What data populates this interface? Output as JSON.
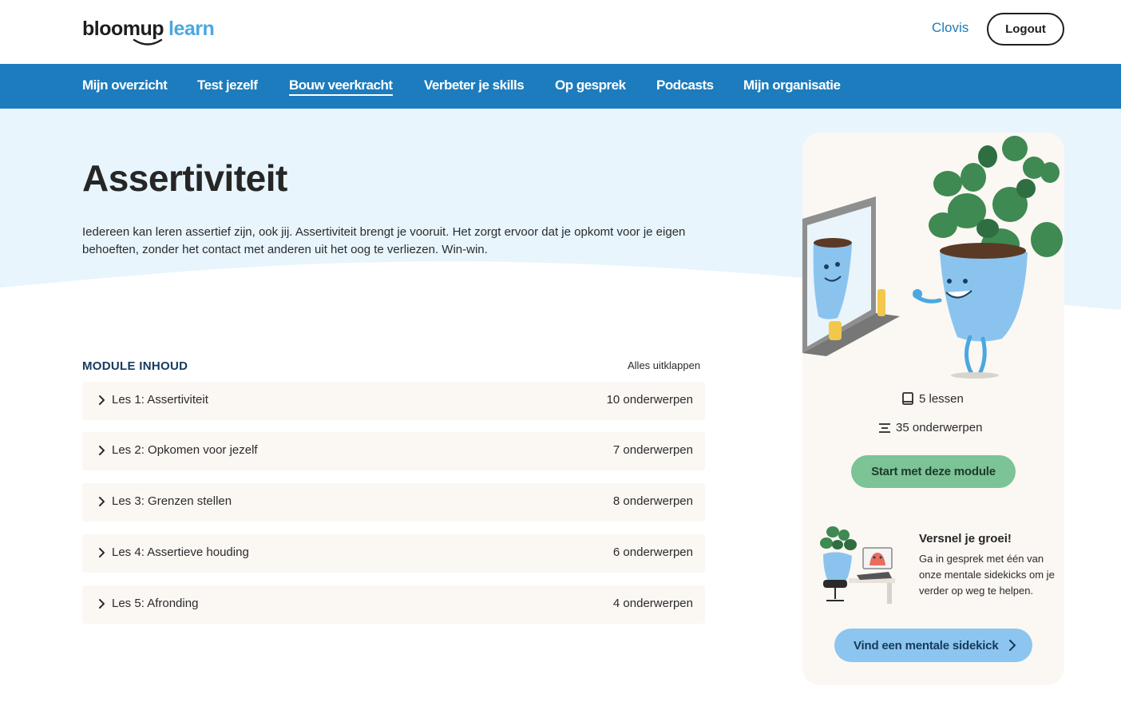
{
  "header": {
    "logo_part1": "bloomup",
    "logo_part2": "learn",
    "user_name": "Clovis",
    "logout_label": "Logout"
  },
  "nav": {
    "items": [
      {
        "label": "Mijn overzicht"
      },
      {
        "label": "Test jezelf"
      },
      {
        "label": "Bouw veerkracht"
      },
      {
        "label": "Verbeter je skills"
      },
      {
        "label": "Op gesprek"
      },
      {
        "label": "Podcasts"
      },
      {
        "label": "Mijn organisatie"
      }
    ],
    "active": "Bouw veerkracht"
  },
  "hero": {
    "title": "Assertiviteit",
    "description": "Iedereen kan leren assertief zijn, ook jij. Assertiviteit brengt je vooruit. Het zorgt ervoor dat je opkomt voor je eigen behoeften, zonder het contact met anderen uit het oog te verliezen. Win-win."
  },
  "module": {
    "header": "MODULE INHOUD",
    "expand_all": "Alles uitklappen",
    "lessons": [
      {
        "title": "Les 1: Assertiviteit",
        "count": "10 onderwerpen"
      },
      {
        "title": "Les 2: Opkomen voor jezelf",
        "count": "7 onderwerpen"
      },
      {
        "title": "Les 3: Grenzen stellen",
        "count": "8 onderwerpen"
      },
      {
        "title": "Les 4: Assertieve houding",
        "count": "6 onderwerpen"
      },
      {
        "title": "Les 5: Afronding",
        "count": "4 onderwerpen"
      }
    ]
  },
  "sidebar": {
    "lessons_count": "5 lessen",
    "topics_count": "35 onderwerpen",
    "start_label": "Start met deze module",
    "promo_title": "Versnel je groei!",
    "promo_text": "Ga in gesprek met één van onze mentale sidekicks om je verder op weg te helpen.",
    "sidekick_label": "Vind een mentale sidekick"
  },
  "colors": {
    "nav_bg": "#1c7cbd",
    "hero_bg": "#e8f5fd",
    "start_btn": "#7cc396",
    "sidekick_btn": "#8cc5ef",
    "card_bg": "#fbf7f3"
  }
}
